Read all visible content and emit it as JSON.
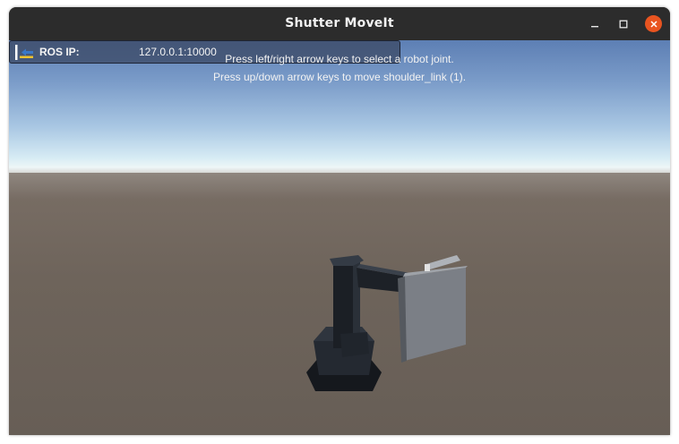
{
  "window": {
    "title": "Shutter MoveIt",
    "controls": [
      "minimize-icon",
      "maximize-icon",
      "close-icon"
    ]
  },
  "ros": {
    "label": "ROS IP:",
    "ip": "127.0.0.1:10000"
  },
  "instructions": {
    "line1": "Press left/right arrow keys to select a robot joint.",
    "line2": "Press up/down arrow keys to move shoulder_link (1)."
  },
  "colors": {
    "titlebar": "#2c2c2c",
    "close_button": "#e95420",
    "sky_top": "#5d7fb4",
    "horizon": "#eef6f7",
    "ground": "#6b6158",
    "robot": "#1f232a"
  }
}
